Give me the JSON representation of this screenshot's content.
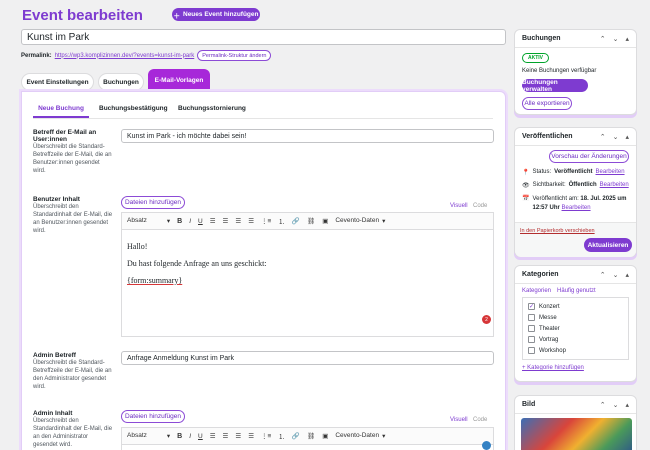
{
  "header": {
    "title": "Event bearbeiten",
    "new_button": "Neues Event hinzufügen"
  },
  "post": {
    "title_value": "Kunst im Park",
    "permalink_label": "Permalink:",
    "permalink_url": "https://wp3.komplizinnen.dev/?events=kunst-im-park",
    "permalink_button": "Permalink-Struktur ändern"
  },
  "main_tabs": [
    "Event Einstellungen",
    "Buchungen",
    "E-Mail-Vorlagen"
  ],
  "sub_tabs": [
    "Neue Buchung",
    "Buchungsbestätigung",
    "Buchungsstornierung"
  ],
  "fields": {
    "subject_user": {
      "title": "Betreff der E-Mail an User:innen",
      "desc": "Überschreibt die Standard-Betreffzeile der E-Mail, die an Benutzer:innen gesendet wird.",
      "value": "Kunst im Park - ich möchte dabei sein!"
    },
    "body_user": {
      "title": "Benutzer Inhalt",
      "desc": "Überschreibt den Standardinhalt der E-Mail, die an Benutzer:innen gesendet wird.",
      "line1": "Hallo!",
      "line2": "Du hast folgende Anfrage an uns geschickt:",
      "line3": "{form:summary}"
    },
    "subject_admin": {
      "title": "Admin Betreff",
      "desc": "Überschreibt die Standard-Betreffzeile der E-Mail, die an den Administrator gesendet wird.",
      "value": "Anfrage Anmeldung Kunst im Park"
    },
    "body_admin": {
      "title": "Admin Inhalt",
      "desc": "Überschreibt den Standardinhalt der E-Mail, die an den Administrator gesendet wird."
    }
  },
  "editor": {
    "add_files": "Dateien hinzufügen",
    "visual": "Visuell",
    "code": "Code",
    "format": "Absatz",
    "cevento": "Cevento-Daten",
    "badge_count": "2"
  },
  "sidebar": {
    "bookings": {
      "title": "Buchungen",
      "status": "AKTIV",
      "empty": "Keine Buchungen verfügbar",
      "manage": "Buchungen verwalten",
      "export": "Alle exportieren"
    },
    "publish": {
      "title": "Veröffentlichen",
      "preview": "Vorschau der Änderungen",
      "status_label": "Status:",
      "status_value": "Veröffentlicht",
      "visibility_label": "Sichtbarkeit:",
      "visibility_value": "Öffentlich",
      "edit": "Bearbeiten",
      "published_label": "Veröffentlicht am:",
      "published_value": "18. Jul. 2025 um 12:57 Uhr",
      "trash": "In den Papierkorb verschieben",
      "update": "Aktualisieren"
    },
    "categories": {
      "title": "Kategorien",
      "tab_all": "Kategorien",
      "tab_popular": "Häufig genutzt",
      "items": [
        {
          "label": "Konzert",
          "checked": true
        },
        {
          "label": "Messe",
          "checked": false
        },
        {
          "label": "Theater",
          "checked": false
        },
        {
          "label": "Vortrag",
          "checked": false
        },
        {
          "label": "Workshop",
          "checked": false
        }
      ],
      "add": "+ Kategorie hinzufügen"
    },
    "image": {
      "title": "Bild"
    }
  },
  "colors": {
    "accent": "#7e3bd0",
    "tab_active": "#a728d9",
    "link": "#7e3bd0"
  }
}
